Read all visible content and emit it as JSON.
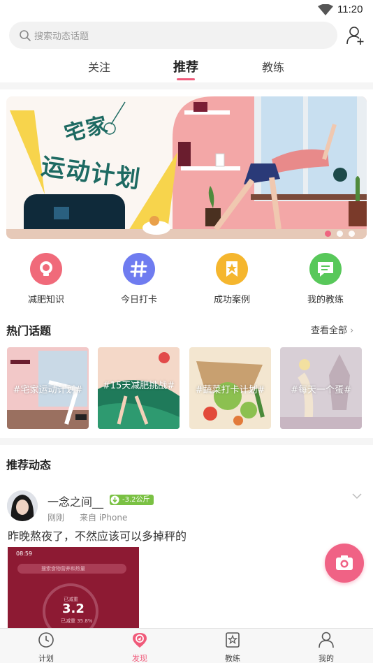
{
  "status_bar": {
    "time": "11:20"
  },
  "search": {
    "placeholder": "搜索动态话题"
  },
  "tabs": [
    {
      "label": "关注",
      "active": false
    },
    {
      "label": "推荐",
      "active": true
    },
    {
      "label": "教练",
      "active": false
    }
  ],
  "banner": {
    "title_line1": "宅家",
    "title_line2": "运动计划",
    "page_count": 3,
    "current_page": 1
  },
  "entries": [
    {
      "label": "减肥知识",
      "icon": "lightbulb-icon",
      "color": "#f06a7a"
    },
    {
      "label": "今日打卡",
      "icon": "hashtag-icon",
      "color": "#6f7cf0"
    },
    {
      "label": "成功案例",
      "icon": "bookmark-star-icon",
      "color": "#f5b62e"
    },
    {
      "label": "我的教练",
      "icon": "message-icon",
      "color": "#58c85a"
    }
  ],
  "hot_topics": {
    "title": "热门话题",
    "view_all": "查看全部",
    "items": [
      {
        "label": "#宅家运动计划#"
      },
      {
        "label": "#15天减肥挑战#"
      },
      {
        "label": "#蔬菜打卡计划#"
      },
      {
        "label": "#每天一个蛋#"
      }
    ]
  },
  "recommend": {
    "title": "推荐动态",
    "post": {
      "username": "一念之间__",
      "badge": "-3.2公斤",
      "time": "刚刚",
      "source": "来自 iPhone",
      "text": "昨晚熬夜了，不然应该可以多掉秤的",
      "image": {
        "clock": "08:59",
        "search_placeholder": "搜索食物营养和热量",
        "value": "3.2",
        "top_label": "已减重",
        "bottom_label": "已减重 35.8%"
      }
    }
  },
  "bottom_nav": [
    {
      "label": "计划",
      "icon": "clock-icon",
      "active": false
    },
    {
      "label": "发现",
      "icon": "discover-icon",
      "active": true
    },
    {
      "label": "教练",
      "icon": "star-badge-icon",
      "active": false
    },
    {
      "label": "我的",
      "icon": "person-icon",
      "active": false
    }
  ],
  "colors": {
    "accent": "#f05a7a",
    "badge_green": "#7ac143",
    "camera": "#f06285"
  }
}
